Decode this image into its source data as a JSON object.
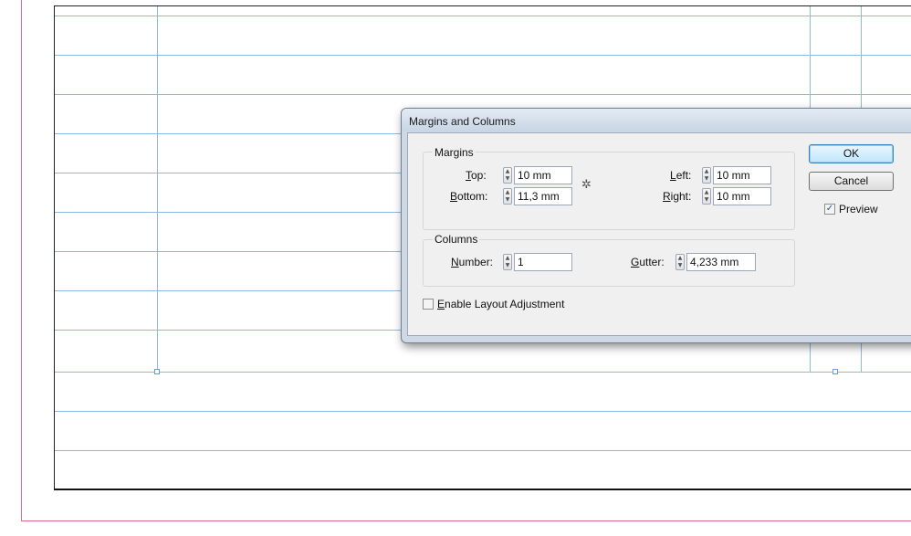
{
  "dialog": {
    "title": "Margins and Columns",
    "margins": {
      "legend": "Margins",
      "top": {
        "label_ul": "T",
        "label_rest": "op:",
        "value": "10 mm"
      },
      "bottom": {
        "label_ul": "B",
        "label_rest": "ottom:",
        "value": "11,3 mm"
      },
      "left": {
        "label_ul": "L",
        "label_rest": "eft:",
        "value": "10 mm"
      },
      "right": {
        "label_ul": "R",
        "label_rest": "ight:",
        "value": "10 mm"
      }
    },
    "columns": {
      "legend": "Columns",
      "number": {
        "label_ul": "N",
        "label_rest": "umber:",
        "value": "1"
      },
      "gutter": {
        "label_ul": "G",
        "label_rest": "utter:",
        "value": "4,233 mm"
      }
    },
    "enable_layout_adjustment": {
      "label_ul": "E",
      "label_rest": "nable Layout Adjustment",
      "checked": false
    },
    "buttons": {
      "ok": "OK",
      "cancel": "Cancel"
    },
    "preview": {
      "label": "Preview",
      "checked": true
    }
  },
  "icons": {
    "chain": "chain-link-icon",
    "spinner": "spinner-arrows-icon",
    "checkmark": "checkmark-icon"
  },
  "colors": {
    "guide": "#8fb8e0",
    "bleed": "#d9708a",
    "dialog_frame": "#cfd9e6",
    "ok_button": "#bee6fd"
  }
}
